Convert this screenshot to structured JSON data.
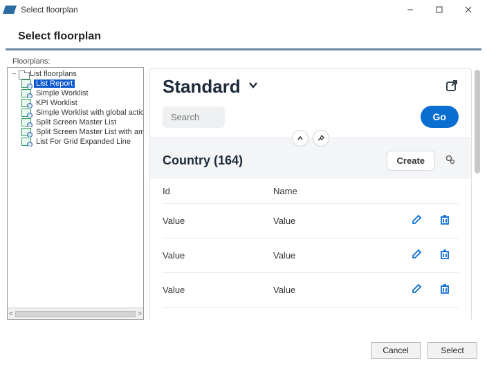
{
  "window": {
    "title": "Select floorplan"
  },
  "header": "Select floorplan",
  "panelLabel": "Floorplans:",
  "tree": {
    "root": "List floorplans",
    "items": [
      {
        "label": "List Report",
        "selected": true
      },
      {
        "label": "Simple Worklist"
      },
      {
        "label": "KPI Worklist"
      },
      {
        "label": "Simple Worklist with global action"
      },
      {
        "label": "Split Screen Master List"
      },
      {
        "label": "Split Screen Master List with amou"
      },
      {
        "label": "List For Grid Expanded Line"
      }
    ]
  },
  "preview": {
    "title": "Standard",
    "searchPlaceholder": "Search",
    "goLabel": "Go",
    "sectionTitle": "Country (164)",
    "createLabel": "Create",
    "columns": {
      "id": "Id",
      "name": "Name"
    },
    "rows": [
      {
        "id": "Value",
        "name": "Value"
      },
      {
        "id": "Value",
        "name": "Value"
      },
      {
        "id": "Value",
        "name": "Value"
      }
    ]
  },
  "dialog": {
    "cancel": "Cancel",
    "select": "Select"
  }
}
